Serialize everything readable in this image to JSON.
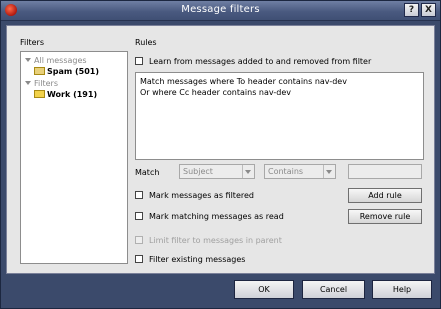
{
  "window": {
    "title": "Message filters",
    "help_glyph": "?",
    "close_glyph": "X"
  },
  "filters_panel": {
    "label": "Filters",
    "tree": [
      {
        "label": "All messages",
        "type": "group"
      },
      {
        "label": "Spam (501)",
        "type": "item"
      },
      {
        "label": "Filters",
        "type": "group"
      },
      {
        "label": "Work (191)",
        "type": "item",
        "selected": true
      }
    ]
  },
  "rules_panel": {
    "label": "Rules",
    "learn_label": "Learn from messages added to and removed from filter",
    "rules": [
      "Match messages where To header contains nav-dev",
      "Or where Cc header contains nav-dev"
    ],
    "match_label": "Match",
    "field_select": "Subject",
    "op_select": "Contains",
    "value_input": ""
  },
  "options": {
    "mark_filtered": "Mark messages as filtered",
    "mark_read": "Mark matching messages as read",
    "limit_parent": "Limit filter to messages in parent",
    "filter_existing": "Filter existing messages"
  },
  "buttons": {
    "add_rule": "Add rule",
    "remove_rule": "Remove rule",
    "ok": "OK",
    "cancel": "Cancel",
    "help": "Help"
  }
}
